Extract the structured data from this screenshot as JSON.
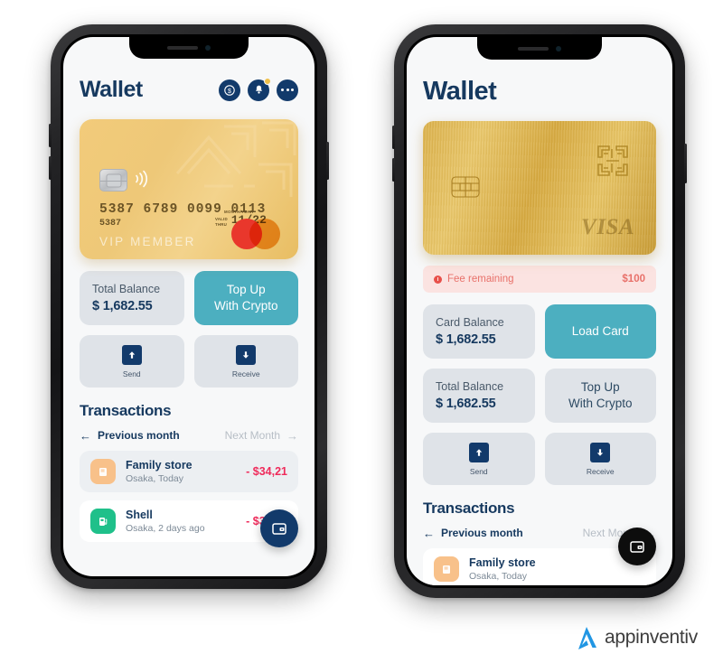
{
  "brand": {
    "name": "appinventiv",
    "logo_icon": "appinventiv-a-mark-icon",
    "accent": "#2196e3"
  },
  "colors": {
    "navy": "#16395f",
    "teal": "#4cafc0",
    "gold": "#eec878",
    "tile_gray": "#dfe3e8",
    "amount_red": "#ef2b5b",
    "fee_pink_bg": "#fbe3e1",
    "fee_red": "#e8716a"
  },
  "left_phone": {
    "header": {
      "title": "Wallet",
      "icons": [
        {
          "name": "coin-dollar-icon",
          "glyph": "$"
        },
        {
          "name": "bell-notification-icon",
          "badge": true
        },
        {
          "name": "more-options-icon"
        }
      ]
    },
    "card": {
      "type": "mastercard",
      "number": "5387   6789   0099   0113",
      "number_short": "5387",
      "expiry_caption_top": "MONTH/YEAR",
      "expiry_label_line1": "VALID",
      "expiry_label_line2": "THRU",
      "expiry": "11/22",
      "member_text": "VIP MEMBER",
      "chip_icon": "emv-chip-icon",
      "contactless_icon": "contactless-wave-icon",
      "network_logo": "mastercard-logo-icon"
    },
    "tiles": {
      "balance_label": "Total Balance",
      "balance_value": "$ 1,682.55",
      "topup_line1": "Top Up",
      "topup_line2": "With Crypto",
      "send_label": "Send",
      "receive_label": "Receive",
      "send_icon": "arrow-up-icon",
      "receive_icon": "arrow-down-icon"
    },
    "transactions": {
      "heading": "Transactions",
      "prev_label": "Previous month",
      "next_label": "Next Month",
      "prev_icon": "arrow-left-icon",
      "next_icon": "arrow-right-icon",
      "items": [
        {
          "name": "Family store",
          "sub": "Osaka, Today",
          "amount": "- $34,21",
          "icon": "store-icon",
          "icon_color": "orange"
        },
        {
          "name": "Shell",
          "sub": "Osaka, 2 days ago",
          "amount": "- $35,88",
          "icon": "fuel-pump-icon",
          "icon_color": "green"
        }
      ]
    },
    "fab": {
      "icon": "wallet-card-icon",
      "color": "navy"
    }
  },
  "right_phone": {
    "header": {
      "title": "Wallet"
    },
    "card": {
      "type": "visa",
      "network_logo": "visa-logo-icon",
      "network_text": "VISA",
      "chip_icon": "emv-chip-icon",
      "pattern_icon": "engraved-maze-icon"
    },
    "fee_banner": {
      "icon": "alert-dot-icon",
      "label": "Fee remaining",
      "amount": "$100"
    },
    "tiles": {
      "card_balance_label": "Card Balance",
      "card_balance_value": "$ 1,682.55",
      "load_card_label": "Load Card",
      "total_balance_label": "Total Balance",
      "total_balance_value": "$ 1,682.55",
      "topup_line1": "Top Up",
      "topup_line2": "With Crypto",
      "send_label": "Send",
      "receive_label": "Receive",
      "send_icon": "arrow-up-icon",
      "receive_icon": "arrow-down-icon"
    },
    "transactions": {
      "heading": "Transactions",
      "prev_label": "Previous month",
      "next_label": "Next Month",
      "prev_icon": "arrow-left-icon",
      "next_icon": "arrow-left-icon",
      "items": [
        {
          "name": "Family store",
          "sub": "Osaka, Today",
          "icon": "store-icon",
          "icon_color": "orange"
        }
      ]
    },
    "fab": {
      "icon": "wallet-card-icon",
      "color": "black"
    }
  }
}
